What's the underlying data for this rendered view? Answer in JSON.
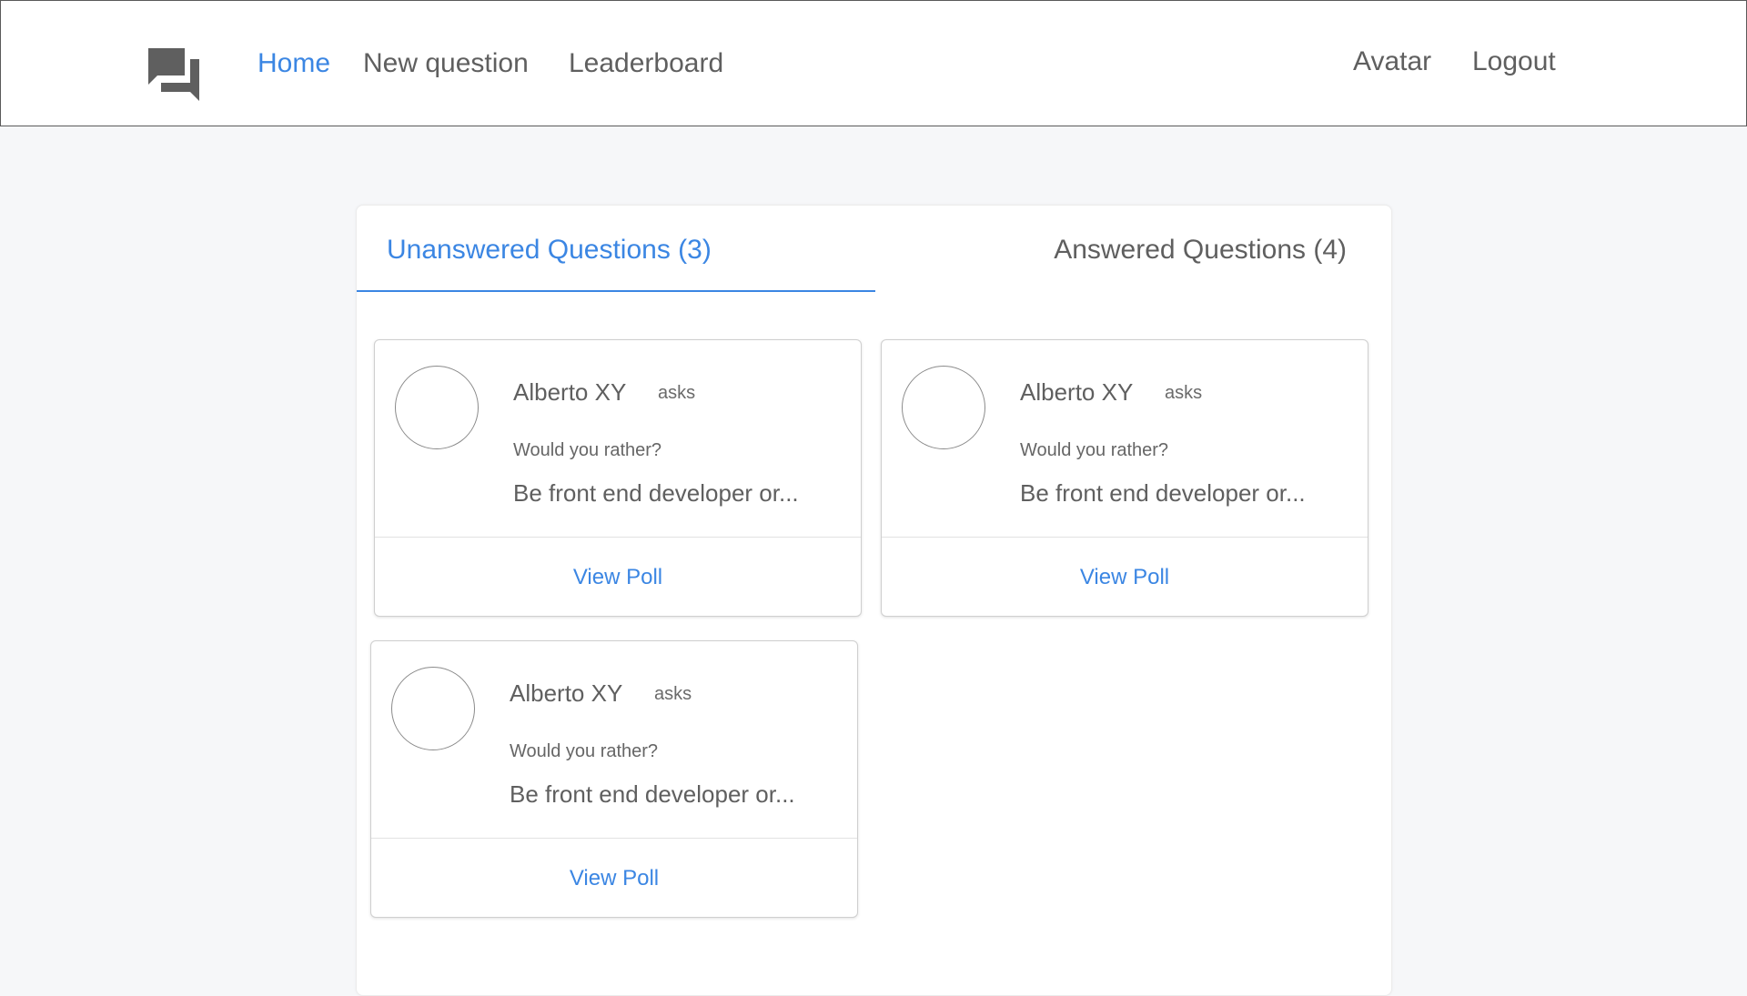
{
  "nav": {
    "logo_icon": "question-answer-icon",
    "home": "Home",
    "new_question": "New question",
    "leaderboard": "Leaderboard",
    "avatar": "Avatar",
    "logout": "Logout"
  },
  "tabs": {
    "unanswered": "Unanswered Questions (3)",
    "answered": "Answered Questions (4)"
  },
  "questions": [
    {
      "author": "Alberto XY",
      "asks": "asks",
      "prompt": "Would you rather?",
      "preview": "Be front end developer or...",
      "action": "View Poll"
    },
    {
      "author": "Alberto XY",
      "asks": "asks",
      "prompt": "Would you rather?",
      "preview": "Be front end developer or...",
      "action": "View Poll"
    },
    {
      "author": "Alberto XY",
      "asks": "asks",
      "prompt": "Would you rather?",
      "preview": "Be front end developer or...",
      "action": "View Poll"
    }
  ],
  "colors": {
    "accent": "#3b86e3",
    "text": "#5f5f5f",
    "background": "#f6f7f9"
  }
}
